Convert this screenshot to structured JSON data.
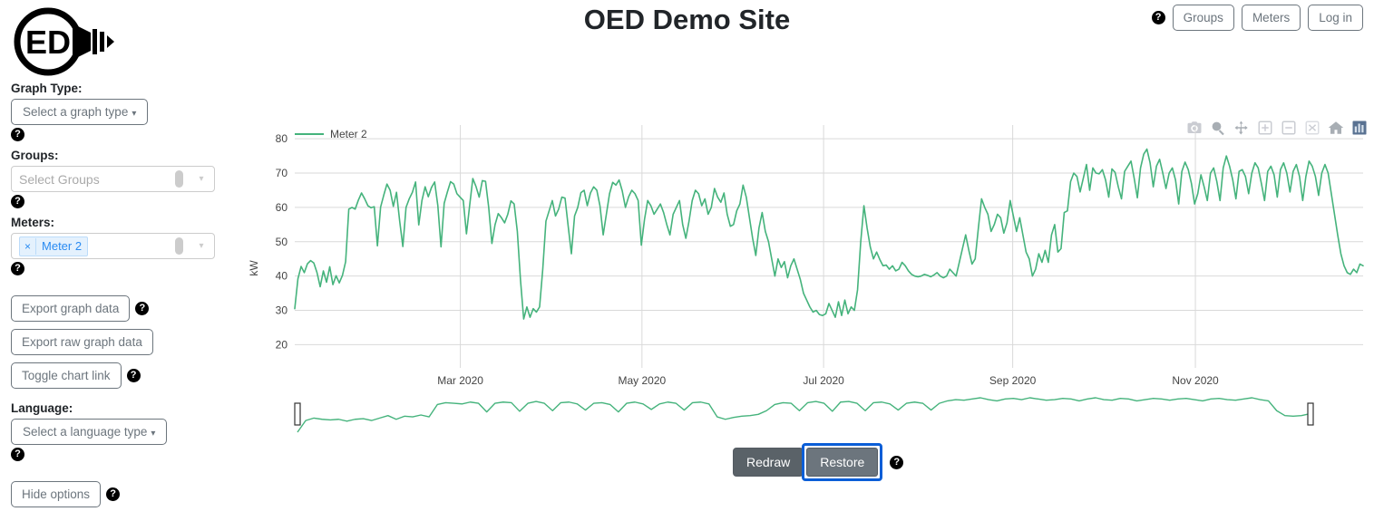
{
  "header": {
    "title": "OED Demo Site",
    "logo_text": "ED",
    "help_icon": "help-icon",
    "buttons": [
      {
        "label": "Groups",
        "name": "groups-button"
      },
      {
        "label": "Meters",
        "name": "meters-button"
      },
      {
        "label": "Log in",
        "name": "login-button"
      }
    ]
  },
  "sidebar": {
    "graph_type": {
      "label": "Graph Type:",
      "selected": "Select a graph type",
      "caret": "▾"
    },
    "groups": {
      "label": "Groups:",
      "placeholder": "Select Groups",
      "caret": "▾"
    },
    "meters": {
      "label": "Meters:",
      "tags": [
        {
          "label": "Meter 2",
          "remove": "×"
        }
      ],
      "caret": "▾"
    },
    "export_graph_label": "Export graph data",
    "export_raw_label": "Export raw graph data",
    "toggle_chart_link_label": "Toggle chart link",
    "language": {
      "label": "Language:",
      "selected": "Select a language type",
      "caret": "▾"
    },
    "hide_options_label": "Hide options"
  },
  "chart": {
    "modebar": [
      {
        "name": "camera-icon",
        "title": "Download plot as a png"
      },
      {
        "name": "zoom-icon",
        "title": "Zoom"
      },
      {
        "name": "pan-icon",
        "title": "Pan"
      },
      {
        "name": "zoom-in-icon",
        "title": "Zoom in"
      },
      {
        "name": "zoom-out-icon",
        "title": "Zoom out"
      },
      {
        "name": "autoscale-icon",
        "title": "Autoscale"
      },
      {
        "name": "reset-axes-icon",
        "title": "Reset axes"
      },
      {
        "name": "toggle-spikelines-icon",
        "title": "Toggle spike lines",
        "active": true
      }
    ],
    "active_icon_color": "#3d5a80"
  },
  "chart_data": {
    "type": "line",
    "title": "",
    "xlabel": "",
    "ylabel": "kW",
    "line_color": "#45b37c",
    "grid": true,
    "legend": [
      {
        "name": "Meter 2",
        "color": "#45b37c"
      }
    ],
    "legend_position": "top-left",
    "ylim": [
      18,
      84
    ],
    "yticks": [
      20,
      30,
      40,
      50,
      60,
      70,
      80
    ],
    "xticks": [
      "Mar 2020",
      "May 2020",
      "Jul 2020",
      "Sep 2020",
      "Nov 2020"
    ],
    "xtick_positions": [
      0.155,
      0.325,
      0.495,
      0.672,
      0.843
    ],
    "has_rangeslider": true,
    "values": [
      30.5,
      39.2,
      42.8,
      41.0,
      43.6,
      44.5,
      43.8,
      41.0,
      36.9,
      41.5,
      38.2,
      42.7,
      37.5,
      40.1,
      38.0,
      40.2,
      44.2,
      59.5,
      60.0,
      59.5,
      62.1,
      64.2,
      62.5,
      60.5,
      59.9,
      60.2,
      48.8,
      60.1,
      63.6,
      66.8,
      65.0,
      60.3,
      64.4,
      56.0,
      48.6,
      60.0,
      62.5,
      64.4,
      67.4,
      54.9,
      62.0,
      66.0,
      63.1,
      65.8,
      67.4,
      60.5,
      48.5,
      61.2,
      64.5,
      67.5,
      66.8,
      64.0,
      63.0,
      62.0,
      52.3,
      60.5,
      68.4,
      66.1,
      63.0,
      67.8,
      67.6,
      60.0,
      49.5,
      55.0,
      58.2,
      57.0,
      55.5,
      58.0,
      61.9,
      61.0,
      53.0,
      38.8,
      27.5,
      31.0,
      28.0,
      30.5,
      29.5,
      31.0,
      42.0,
      56.0,
      59.0,
      62.0,
      57.5,
      59.5,
      63.0,
      62.7,
      54.5,
      46.5,
      57.5,
      60.0,
      64.3,
      65.0,
      60.5,
      64.2,
      66.0,
      65.0,
      60.4,
      52.0,
      58.0,
      64.0,
      67.3,
      66.5,
      68.0,
      64.8,
      60.0,
      63.1,
      65.0,
      64.0,
      62.0,
      49.0,
      56.5,
      62.0,
      60.5,
      58.0,
      59.5,
      61.0,
      58.5,
      55.0,
      52.0,
      58.0,
      60.0,
      62.0,
      55.0,
      51.0,
      56.0,
      62.0,
      65.0,
      64.0,
      60.5,
      62.5,
      58.0,
      60.0,
      65.5,
      63.0,
      61.5,
      64.2,
      58.0,
      54.5,
      55.0,
      59.0,
      61.0,
      66.5,
      63.0,
      57.0,
      51.0,
      46.0,
      54.0,
      58.5,
      53.0,
      50.0,
      45.0,
      40.0,
      45.0,
      42.5,
      44.2,
      39.5,
      43.0,
      45.0,
      42.0,
      39.0,
      35.0,
      33.0,
      31.0,
      29.5,
      30.0,
      28.8,
      28.5,
      29.0,
      32.0,
      30.0,
      28.0,
      32.5,
      28.5,
      33.0,
      29.0,
      31.0,
      30.0,
      36.0,
      50.0,
      60.5,
      54.0,
      48.5,
      45.0,
      47.0,
      44.8,
      43.0,
      43.2,
      42.0,
      43.0,
      41.5,
      42.0,
      44.0,
      43.0,
      41.5,
      40.5,
      40.0,
      39.8,
      40.0,
      40.5,
      40.2,
      39.8,
      40.3,
      41.0,
      40.0,
      39.5,
      40.0,
      42.0,
      41.0,
      40.0,
      44.0,
      48.0,
      52.0,
      47.5,
      43.5,
      45.0,
      54.0,
      62.5,
      60.0,
      58.0,
      53.0,
      55.0,
      58.0,
      57.0,
      52.5,
      55.5,
      62.0,
      57.5,
      53.0,
      57.0,
      52.0,
      47.0,
      45.0,
      40.0,
      42.0,
      46.5,
      44.0,
      47.5,
      44.0,
      52.0,
      55.0,
      47.0,
      48.0,
      58.5,
      59.0,
      67.5,
      70.0,
      69.0,
      64.5,
      68.5,
      72.5,
      65.0,
      71.5,
      70.0,
      69.8,
      71.0,
      68.0,
      63.0,
      71.2,
      70.2,
      66.0,
      62.5,
      70.5,
      72.0,
      73.5,
      68.5,
      62.8,
      71.5,
      75.5,
      77.0,
      73.0,
      66.0,
      72.0,
      74.0,
      70.0,
      65.5,
      70.0,
      71.5,
      68.0,
      61.0,
      70.5,
      73.2,
      71.0,
      67.0,
      61.0,
      64.0,
      69.5,
      66.0,
      62.0,
      70.0,
      71.5,
      67.5,
      62.0,
      71.5,
      75.0,
      72.0,
      68.0,
      62.5,
      70.5,
      71.0,
      69.0,
      64.0,
      70.0,
      73.0,
      71.5,
      67.0,
      62.0,
      70.5,
      72.0,
      69.5,
      63.0,
      71.0,
      73.0,
      70.0,
      64.5,
      70.5,
      72.5,
      69.0,
      62.0,
      69.0,
      73.5,
      72.0,
      69.0,
      63.5,
      70.0,
      72.5,
      70.0,
      64.0,
      58.0,
      52.0,
      46.5,
      43.0,
      41.0,
      40.5,
      42.0,
      41.0,
      43.5,
      43.0
    ],
    "rangeslider_values": [
      30.5,
      40.0,
      42.0,
      41.0,
      40.5,
      41.0,
      39.5,
      41.0,
      41.5,
      40.0,
      42.0,
      44.0,
      41.0,
      43.5,
      43.0,
      44.5,
      43.0,
      53.0,
      54.5,
      54.0,
      53.5,
      55.0,
      54.0,
      47.0,
      54.0,
      55.0,
      54.5,
      47.5,
      54.0,
      55.5,
      54.0,
      48.0,
      54.5,
      55.0,
      53.5,
      48.5,
      54.0,
      54.5,
      53.0,
      47.0,
      54.0,
      55.0,
      53.5,
      49.0,
      53.5,
      55.0,
      54.0,
      48.5,
      54.5,
      55.0,
      53.5,
      43.0,
      41.0,
      42.5,
      43.5,
      44.0,
      45.0,
      48.0,
      53.0,
      54.5,
      54.0,
      48.0,
      54.5,
      55.5,
      54.0,
      47.5,
      55.0,
      55.5,
      54.0,
      48.0,
      54.5,
      55.0,
      53.5,
      48.5,
      54.0,
      55.0,
      54.0,
      48.5,
      54.0,
      56.0,
      57.0,
      56.5,
      57.5,
      58.5,
      57.0,
      56.0,
      57.5,
      58.0,
      57.0,
      58.5,
      57.5,
      56.5,
      57.0,
      58.0,
      57.5,
      56.0,
      57.5,
      58.5,
      57.0,
      56.5,
      58.0,
      57.5,
      56.0,
      57.0,
      58.0,
      57.5,
      56.5,
      57.5,
      58.0,
      57.0,
      56.0,
      57.5,
      58.0,
      57.0,
      56.5,
      57.5,
      58.5,
      57.0,
      56.0,
      48.0,
      44.0,
      43.5,
      44.0,
      45.5
    ]
  },
  "footer": {
    "redraw_label": "Redraw",
    "restore_label": "Restore",
    "restore_focused": true,
    "help_icon": "help-icon"
  }
}
